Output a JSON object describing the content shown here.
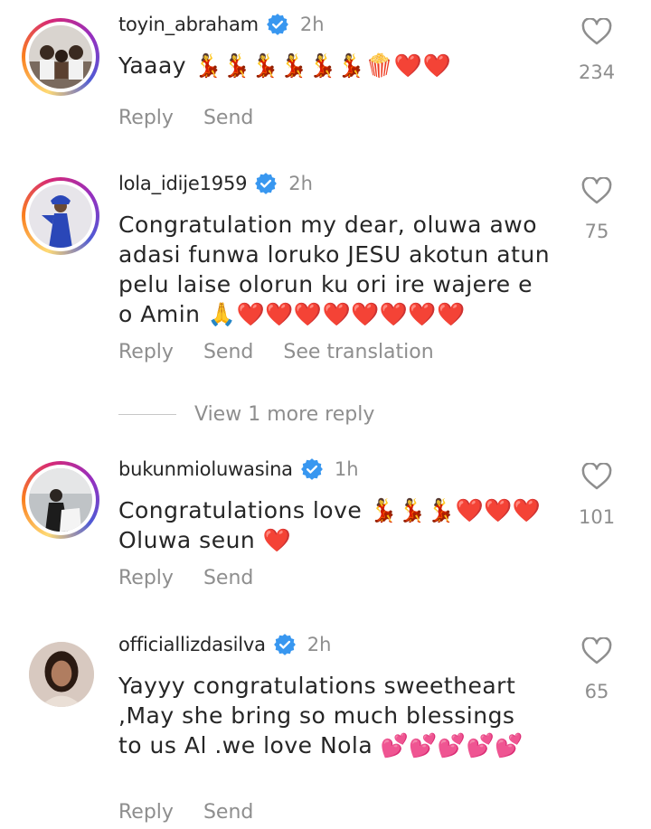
{
  "comments": [
    {
      "username": "toyin_abraham",
      "time": "2h",
      "text": "Yaaay 💃💃💃💃💃💃🍿❤️❤️",
      "likes": "234",
      "reply_label": "Reply",
      "send_label": "Send"
    },
    {
      "username": "lola_idije1959",
      "time": "2h",
      "text": "Congratulation my dear, oluwa awo adasi funwa loruko JESU akotun atun pelu laise olorun ku ori ire wajere e o Amin 🙏❤️❤️❤️❤️❤️❤️❤️❤️",
      "likes": "75",
      "reply_label": "Reply",
      "send_label": "Send",
      "translate_label": "See translation",
      "view_more": "View 1 more reply"
    },
    {
      "username": "bukunmioluwasina",
      "time": "1h",
      "text": "Congratulations love 💃💃💃❤️❤️❤️\nOluwa seun ❤️",
      "likes": "101",
      "reply_label": "Reply",
      "send_label": "Send"
    },
    {
      "username": "officiallizdasilva",
      "time": "2h",
      "text": "Yayyy congratulations sweetheart ,May she bring so much blessings to us Al .we love Nola 💕💕💕💕💕",
      "likes": "65",
      "reply_label": "Reply",
      "send_label": "Send"
    }
  ],
  "colors": {
    "verified": "#3897f0",
    "secondary_text": "#8e8e8e",
    "primary_text": "#262626"
  }
}
